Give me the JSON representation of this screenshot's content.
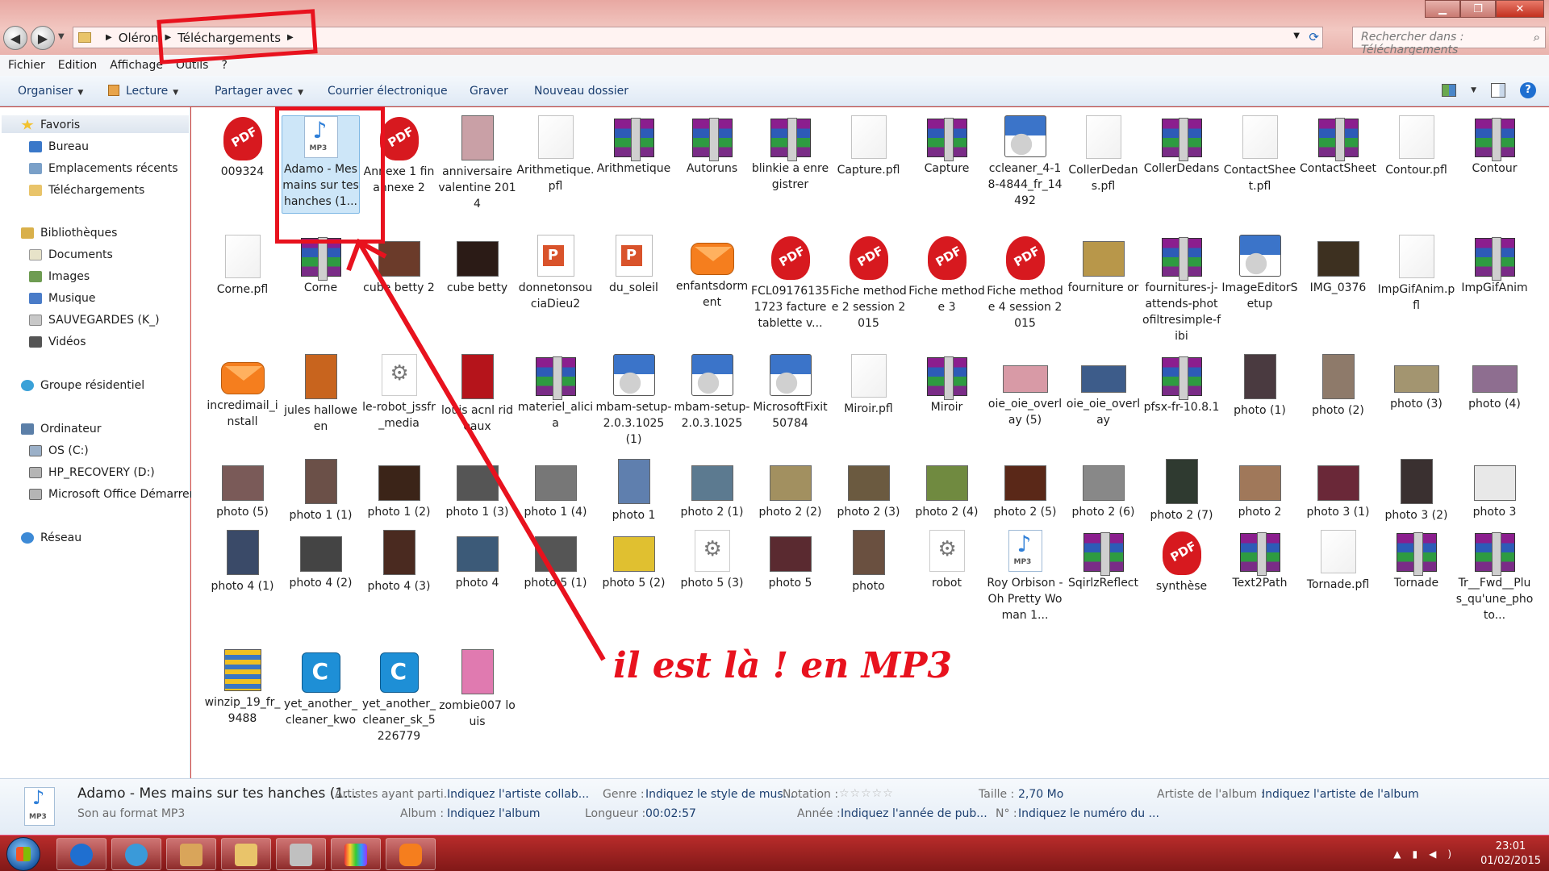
{
  "window": {
    "breadcrumb": [
      "Oléron",
      "Téléchargements"
    ],
    "search_placeholder": "Rechercher dans : Téléchargements"
  },
  "menu": [
    "Fichier",
    "Edition",
    "Affichage",
    "Outils",
    "?"
  ],
  "toolbar": {
    "organiser": "Organiser",
    "lecture": "Lecture",
    "partager": "Partager avec",
    "courrier": "Courrier électronique",
    "graver": "Graver",
    "nouveau_dossier": "Nouveau dossier"
  },
  "sidebar": {
    "favoris": "Favoris",
    "favoris_items": [
      "Bureau",
      "Emplacements récents",
      "Téléchargements"
    ],
    "bibliotheques": "Bibliothèques",
    "bibliotheques_items": [
      "Documents",
      "Images",
      "Musique",
      "SAUVEGARDES (K_)",
      "Vidéos"
    ],
    "groupe": "Groupe résidentiel",
    "ordinateur": "Ordinateur",
    "ordinateur_items": [
      "OS (C:)",
      "HP_RECOVERY (D:)",
      "Microsoft Office Démarrer"
    ],
    "reseau": "Réseau"
  },
  "files": [
    {
      "label": "009324",
      "type": "pdf"
    },
    {
      "label": "Adamo - Mes mains sur tes hanches (1...",
      "type": "mp3",
      "selected": true
    },
    {
      "label": "Annexe 1 fin annexe 2",
      "type": "pdf"
    },
    {
      "label": "anniversaire valentine 2014",
      "type": "tall",
      "color": "#c9a0a6"
    },
    {
      "label": "Arithmetique.pfl",
      "type": "pfl"
    },
    {
      "label": "Arithmetique",
      "type": "rar"
    },
    {
      "label": "Autoruns",
      "type": "rar"
    },
    {
      "label": "blinkie a enregistrer",
      "type": "rar"
    },
    {
      "label": "Capture.pfl",
      "type": "pfl"
    },
    {
      "label": "Capture",
      "type": "rar"
    },
    {
      "label": "ccleaner_4-18-4844_fr_14492",
      "type": "setup"
    },
    {
      "label": "CollerDedans.pfl",
      "type": "pfl"
    },
    {
      "label": "CollerDedans",
      "type": "rar"
    },
    {
      "label": "ContactSheet.pfl",
      "type": "pfl"
    },
    {
      "label": "ContactSheet",
      "type": "rar"
    },
    {
      "label": "Contour.pfl",
      "type": "pfl"
    },
    {
      "label": "Contour",
      "type": "rar"
    },
    {
      "label": "Corne.pfl",
      "type": "pfl"
    },
    {
      "label": "Corne",
      "type": "rar"
    },
    {
      "label": "cube betty 2",
      "type": "img",
      "color": "#6b3b2a"
    },
    {
      "label": "cube betty",
      "type": "img",
      "color": "#2b1b16"
    },
    {
      "label": "donnetonsouciaDieu2",
      "type": "pptx"
    },
    {
      "label": "du_soleil",
      "type": "pptx"
    },
    {
      "label": "enfantsdorment",
      "type": "mail"
    },
    {
      "label": "FCL091761351723 facture tablette v...",
      "type": "pdf"
    },
    {
      "label": "Fiche methode 2 session 2015",
      "type": "pdf"
    },
    {
      "label": "Fiche methode 3",
      "type": "pdf"
    },
    {
      "label": "Fiche methode 4 session 2015",
      "type": "pdf"
    },
    {
      "label": "fourniture or",
      "type": "img",
      "color": "#b8974a"
    },
    {
      "label": "fournitures-j-attends-photofiltresimple-fibi",
      "type": "rar"
    },
    {
      "label": "ImageEditorSetup",
      "type": "setup"
    },
    {
      "label": "IMG_0376",
      "type": "img",
      "color": "#3d3020"
    },
    {
      "label": "ImpGifAnim.pfl",
      "type": "pfl"
    },
    {
      "label": "ImpGifAnim",
      "type": "rar"
    },
    {
      "label": "incredimail_install",
      "type": "mail"
    },
    {
      "label": "jules halloween",
      "type": "tall",
      "color": "#c8641e"
    },
    {
      "label": "le-robot_jssfr_media",
      "type": "robot"
    },
    {
      "label": "louis acnl rideaux",
      "type": "tall",
      "color": "#b5141b"
    },
    {
      "label": "materiel_alicia",
      "type": "rar"
    },
    {
      "label": "mbam-setup-2.0.3.1025 (1)",
      "type": "setup"
    },
    {
      "label": "mbam-setup-2.0.3.1025",
      "type": "setup"
    },
    {
      "label": "MicrosoftFixit50784",
      "type": "setup"
    },
    {
      "label": "Miroir.pfl",
      "type": "pfl"
    },
    {
      "label": "Miroir",
      "type": "rar"
    },
    {
      "label": "oie_oie_overlay (5)",
      "type": "wide",
      "color": "#d89aa6"
    },
    {
      "label": "oie_oie_overlay",
      "type": "wide",
      "color": "#3d5c8a"
    },
    {
      "label": "pfsx-fr-10.8.1",
      "type": "rar"
    },
    {
      "label": "photo (1)",
      "type": "tall",
      "color": "#4a3a40"
    },
    {
      "label": "photo (2)",
      "type": "tall",
      "color": "#8e7a6a"
    },
    {
      "label": "photo (3)",
      "type": "wide",
      "color": "#a39570"
    },
    {
      "label": "photo (4)",
      "type": "wide",
      "color": "#8e6e90"
    },
    {
      "label": "photo (5)",
      "type": "img",
      "color": "#7a5a58"
    },
    {
      "label": "photo 1 (1)",
      "type": "tall",
      "color": "#6b5048"
    },
    {
      "label": "photo 1 (2)",
      "type": "img",
      "color": "#3b2418"
    },
    {
      "label": "photo 1 (3)",
      "type": "img",
      "color": "#555555"
    },
    {
      "label": "photo 1 (4)",
      "type": "img",
      "color": "#777777"
    },
    {
      "label": "photo 1",
      "type": "tall",
      "color": "#5f7fae"
    },
    {
      "label": "photo 2 (1)",
      "type": "img",
      "color": "#5c7a90"
    },
    {
      "label": "photo 2 (2)",
      "type": "img",
      "color": "#a29060"
    },
    {
      "label": "photo 2 (3)",
      "type": "img",
      "color": "#6b5a40"
    },
    {
      "label": "photo 2 (4)",
      "type": "img",
      "color": "#708a40"
    },
    {
      "label": "photo 2 (5)",
      "type": "img",
      "color": "#5a2818"
    },
    {
      "label": "photo 2 (6)",
      "type": "img",
      "color": "#888888"
    },
    {
      "label": "photo 2 (7)",
      "type": "tall",
      "color": "#2f3a30"
    },
    {
      "label": "photo 2",
      "type": "img",
      "color": "#a0785a"
    },
    {
      "label": "photo 3 (1)",
      "type": "img",
      "color": "#6a2838"
    },
    {
      "label": "photo 3 (2)",
      "type": "tall",
      "color": "#3a3030"
    },
    {
      "label": "photo 3",
      "type": "img",
      "color": "#e8e8e8"
    },
    {
      "label": "photo 4 (1)",
      "type": "tall",
      "color": "#3a4a68"
    },
    {
      "label": "photo 4 (2)",
      "type": "img",
      "color": "#444444"
    },
    {
      "label": "photo 4 (3)",
      "type": "tall",
      "color": "#4a2a20"
    },
    {
      "label": "photo 4",
      "type": "img",
      "color": "#3c5a78"
    },
    {
      "label": "photo 5 (1)",
      "type": "img",
      "color": "#555555"
    },
    {
      "label": "photo 5 (2)",
      "type": "img",
      "color": "#e0c030"
    },
    {
      "label": "photo 5 (3)",
      "type": "robot"
    },
    {
      "label": "photo 5",
      "type": "img",
      "color": "#5a2a30"
    },
    {
      "label": "photo",
      "type": "tall",
      "color": "#6a5040"
    },
    {
      "label": "robot",
      "type": "robot"
    },
    {
      "label": "Roy Orbison - Oh Pretty Woman 1...",
      "type": "mp3"
    },
    {
      "label": "SqirlzReflect",
      "type": "rar"
    },
    {
      "label": "synthèse",
      "type": "pdf"
    },
    {
      "label": "Text2Path",
      "type": "rar"
    },
    {
      "label": "Tornade.pfl",
      "type": "pfl"
    },
    {
      "label": "Tornade",
      "type": "rar"
    },
    {
      "label": "Tr__Fwd__Plus_qu'une_photo...",
      "type": "rar"
    },
    {
      "label": "winzip_19_fr_9488",
      "type": "zip"
    },
    {
      "label": "yet_another_cleaner_kwo",
      "type": "ccl"
    },
    {
      "label": "yet_another_cleaner_sk_5226779",
      "type": "ccl"
    },
    {
      "label": "zombie007 louis",
      "type": "tall",
      "color": "#e07ab0"
    }
  ],
  "details": {
    "title": "Adamo - Mes mains sur tes hanches (1...",
    "type": "Son au format MP3",
    "artistes_label": "Artistes ayant parti...",
    "artistes_value": "Indiquez l'artiste collab...",
    "album_label": "Album :",
    "album_value": "Indiquez l'album",
    "genre_label": "Genre :",
    "genre_value": "Indiquez le style de mus...",
    "longueur_label": "Longueur :",
    "longueur_value": "00:02:57",
    "notation_label": "Notation :",
    "notation_stars": "☆☆☆☆☆",
    "annee_label": "Année :",
    "annee_value": "Indiquez l'année de pub...",
    "taille_label": "Taille :",
    "taille_value": "2,70 Mo",
    "numero_label": "N° :",
    "numero_value": "Indiquez le numéro du ...",
    "artiste_album_label": "Artiste de l'album :",
    "artiste_album_value": "Indiquez l'artiste de l'album"
  },
  "taskbar": {
    "time": "23:01",
    "date": "01/02/2015"
  },
  "annotation": {
    "caption": "il est là ! en MP3",
    "color": "#e8121e"
  }
}
